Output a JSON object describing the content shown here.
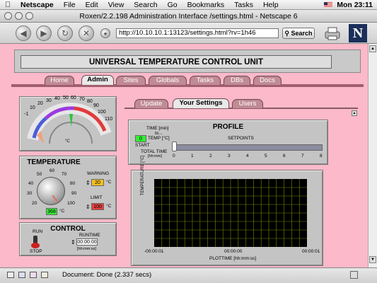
{
  "menubar": {
    "app": "Netscape",
    "items": [
      "File",
      "Edit",
      "View",
      "Search",
      "Go",
      "Bookmarks",
      "Tasks",
      "Help"
    ],
    "clock": "Mon 23:11"
  },
  "window": {
    "title": "Roxen/2.2.198 Administration Interface /settings.html - Netscape 6"
  },
  "toolbar": {
    "url": "http://10.10.10.1:13123/settings.html?rv=1h46",
    "search_label": "Search",
    "logo_letter": "N"
  },
  "page": {
    "header": "UNIVERSAL  TEMPERATURE  CONTROL UNIT",
    "main_tabs": [
      {
        "label": "Home"
      },
      {
        "label": "Admin",
        "active": true
      },
      {
        "label": "Sites"
      },
      {
        "label": "Globals"
      },
      {
        "label": "Tasks"
      },
      {
        "label": "DBs"
      },
      {
        "label": "Docs"
      }
    ],
    "sub_tabs": [
      {
        "label": "Update"
      },
      {
        "label": "Your Settings",
        "active": true
      },
      {
        "label": "Users"
      }
    ]
  },
  "meter": {
    "scale": [
      "-1",
      "10",
      "20",
      "30",
      "40",
      "50",
      "60",
      "70",
      "80",
      "90",
      "100",
      "110"
    ],
    "unit": "°C"
  },
  "temperature": {
    "title": "TEMPERATURE",
    "knob_scale": [
      "20",
      "30",
      "40",
      "50",
      "60",
      "70",
      "80",
      "90",
      "100"
    ],
    "current": "368",
    "unit": "°C",
    "warning_label": "WARNING",
    "warning_value": "20",
    "limit_label": "LIMIT",
    "limit_value": "100"
  },
  "control": {
    "title": "CONTROL",
    "run_label": "RUN",
    "stop_label": "STOP",
    "runtime_label": "RUNTIME",
    "runtime_value": "00:00:00",
    "runtime_format": "[hh:mm:ss]"
  },
  "profile": {
    "title": "PROFILE",
    "time_label": "TIME [min]",
    "to_label": "to...",
    "temp_label": "TEMP [°C]",
    "start_value": "0",
    "start_label": "START",
    "setpoints_label": "SETPOINTS",
    "total_time_label": "TOTAL TIME",
    "total_time_unit": "[hh:mm]",
    "slider_ticks": [
      "0",
      "1",
      "2",
      "3",
      "4",
      "5",
      "6",
      "7",
      "8"
    ],
    "slider_value": 0
  },
  "plot": {
    "ylabel": "TEMPERATURE [°C]",
    "xlabel": "PLOTTIME [hh:mm:ss]",
    "xticks": [
      "-00:00:01",
      "00:00:00",
      "00:00:01"
    ]
  },
  "status": {
    "text": "Document: Done (2.337 secs)"
  },
  "colors": {
    "page_bg": "#fbb9c9",
    "panel": "#c4c4c4",
    "tab": "#c08b94",
    "plot_bg": "#000000",
    "plot_grid": "#7a8a00",
    "green_box": "#33ee33",
    "warning_box": "#f4c020",
    "limit_box": "#e64141"
  }
}
